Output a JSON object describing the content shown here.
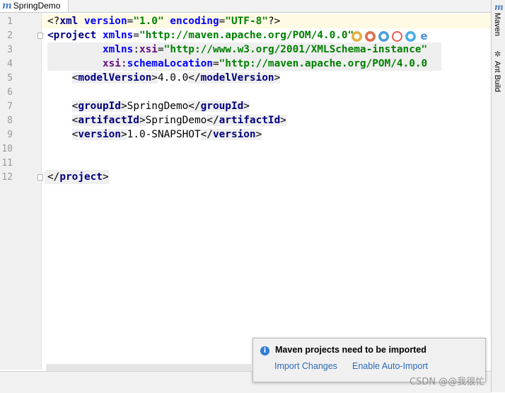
{
  "tab": {
    "icon": "m",
    "label": "SpringDemo"
  },
  "right_tool_windows": [
    {
      "label": "Maven",
      "icon": "maven-m-icon"
    },
    {
      "label": "Ant Build",
      "icon": "ant-icon"
    }
  ],
  "line_numbers": [
    "1",
    "2",
    "3",
    "4",
    "5",
    "6",
    "7",
    "8",
    "9",
    "10",
    "11",
    "12"
  ],
  "code": {
    "l1": {
      "open": "<?",
      "name": "xml",
      "a1": " version",
      "eq1": "=",
      "v1": "\"1.0\"",
      "a2": " encoding",
      "eq2": "=",
      "v2": "\"UTF-8\"",
      "close": "?>"
    },
    "l2": {
      "open": "<",
      "tag": "project",
      "a1": " xmlns",
      "eq1": "=",
      "v1": "\"http://maven.apache.org/POM/4.0.0\""
    },
    "l3": {
      "indent": "         ",
      "ns": "xmlns",
      "colon": ":",
      "a1": "xsi",
      "eq1": "=",
      "v1": "\"http://www.w3.org/2001/XMLSchema-instance\""
    },
    "l4": {
      "indent": "         ",
      "ns": "xsi",
      "colon": ":",
      "a1": "schemaLocation",
      "eq1": "=",
      "v1": "\"http://maven.apache.org/POM/4.0.0"
    },
    "l5": {
      "indent": "    ",
      "open": "<",
      "tag": "modelVersion",
      "gt": ">",
      "text": "4.0.0",
      "close_open": "</",
      "close_tag": "modelVersion",
      "close_gt": ">"
    },
    "l7": {
      "indent": "    ",
      "open": "<",
      "tag": "groupId",
      "gt": ">",
      "text": "SpringDemo",
      "close_open": "</",
      "close_tag": "groupId",
      "close_gt": ">"
    },
    "l8": {
      "indent": "    ",
      "open": "<",
      "tag": "artifactId",
      "gt": ">",
      "text": "SpringDemo",
      "close_open": "</",
      "close_tag": "artifactId",
      "close_gt": ">"
    },
    "l9": {
      "indent": "    ",
      "open": "<",
      "tag": "version",
      "gt": ">",
      "text": "1.0-SNAPSHOT",
      "close_open": "</",
      "close_tag": "version",
      "close_gt": ">"
    },
    "l12": {
      "open": "</",
      "tag": "project",
      "gt": ">"
    }
  },
  "notification": {
    "title": "Maven projects need to be imported",
    "link_import": "Import Changes",
    "link_auto": "Enable Auto-Import"
  },
  "watermark": "CSDN @@我很忙",
  "colors": {
    "tag": "#000080",
    "attribute": "#0000ff",
    "namespace": "#660e7a",
    "string": "#008000",
    "link": "#2d6ab7",
    "caret_line": "#fffae3"
  }
}
